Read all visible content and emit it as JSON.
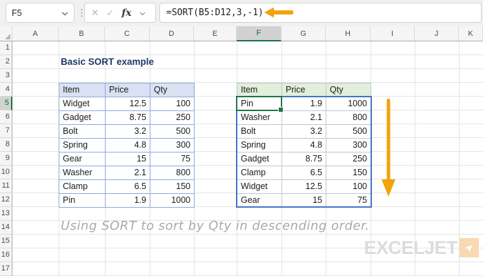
{
  "formula_bar": {
    "name_box": "F5",
    "fx_label": "fx",
    "formula": "=SORT(B5:D12,3,-1)"
  },
  "icons": {
    "cancel": "✕",
    "confirm": "✓",
    "drag_dots": "⋮",
    "logo_arrow": "➤"
  },
  "grid": {
    "column_headers": [
      "A",
      "B",
      "C",
      "D",
      "E",
      "F",
      "G",
      "H",
      "I",
      "J",
      "K"
    ],
    "row_headers": [
      "1",
      "2",
      "3",
      "4",
      "5",
      "6",
      "7",
      "8",
      "9",
      "10",
      "11",
      "12",
      "13",
      "14",
      "15",
      "16",
      "17"
    ],
    "selected_column": "F",
    "selected_row": "5",
    "active_cell": "F5"
  },
  "content": {
    "title": "Basic SORT example",
    "caption": "Using SORT to sort by Qty in descending order."
  },
  "left_table": {
    "headers": [
      "Item",
      "Price",
      "Qty"
    ],
    "rows": [
      [
        "Widget",
        "12.5",
        "100"
      ],
      [
        "Gadget",
        "8.75",
        "250"
      ],
      [
        "Bolt",
        "3.2",
        "500"
      ],
      [
        "Spring",
        "4.8",
        "300"
      ],
      [
        "Gear",
        "15",
        "75"
      ],
      [
        "Washer",
        "2.1",
        "800"
      ],
      [
        "Clamp",
        "6.5",
        "150"
      ],
      [
        "Pin",
        "1.9",
        "1000"
      ]
    ]
  },
  "right_table": {
    "headers": [
      "Item",
      "Price",
      "Qty"
    ],
    "rows": [
      [
        "Pin",
        "1.9",
        "1000"
      ],
      [
        "Washer",
        "2.1",
        "800"
      ],
      [
        "Bolt",
        "3.2",
        "500"
      ],
      [
        "Spring",
        "4.8",
        "300"
      ],
      [
        "Gadget",
        "8.75",
        "250"
      ],
      [
        "Clamp",
        "6.5",
        "150"
      ],
      [
        "Widget",
        "12.5",
        "100"
      ],
      [
        "Gear",
        "15",
        "75"
      ]
    ]
  },
  "logo": {
    "text": "EXCELJET"
  },
  "colors": {
    "accent_orange": "#F0A30A",
    "selection_green": "#217346",
    "spill_blue": "#4472C4",
    "left_table_header_fill": "#D9E1F2",
    "right_table_header_fill": "#E2EFDA",
    "left_table_border": "#8EA9DB",
    "title_text": "#1F3864",
    "caption_text": "#A9A9A9",
    "logo_gray": "#DCDCDC",
    "logo_square": "#F9D9B4"
  }
}
